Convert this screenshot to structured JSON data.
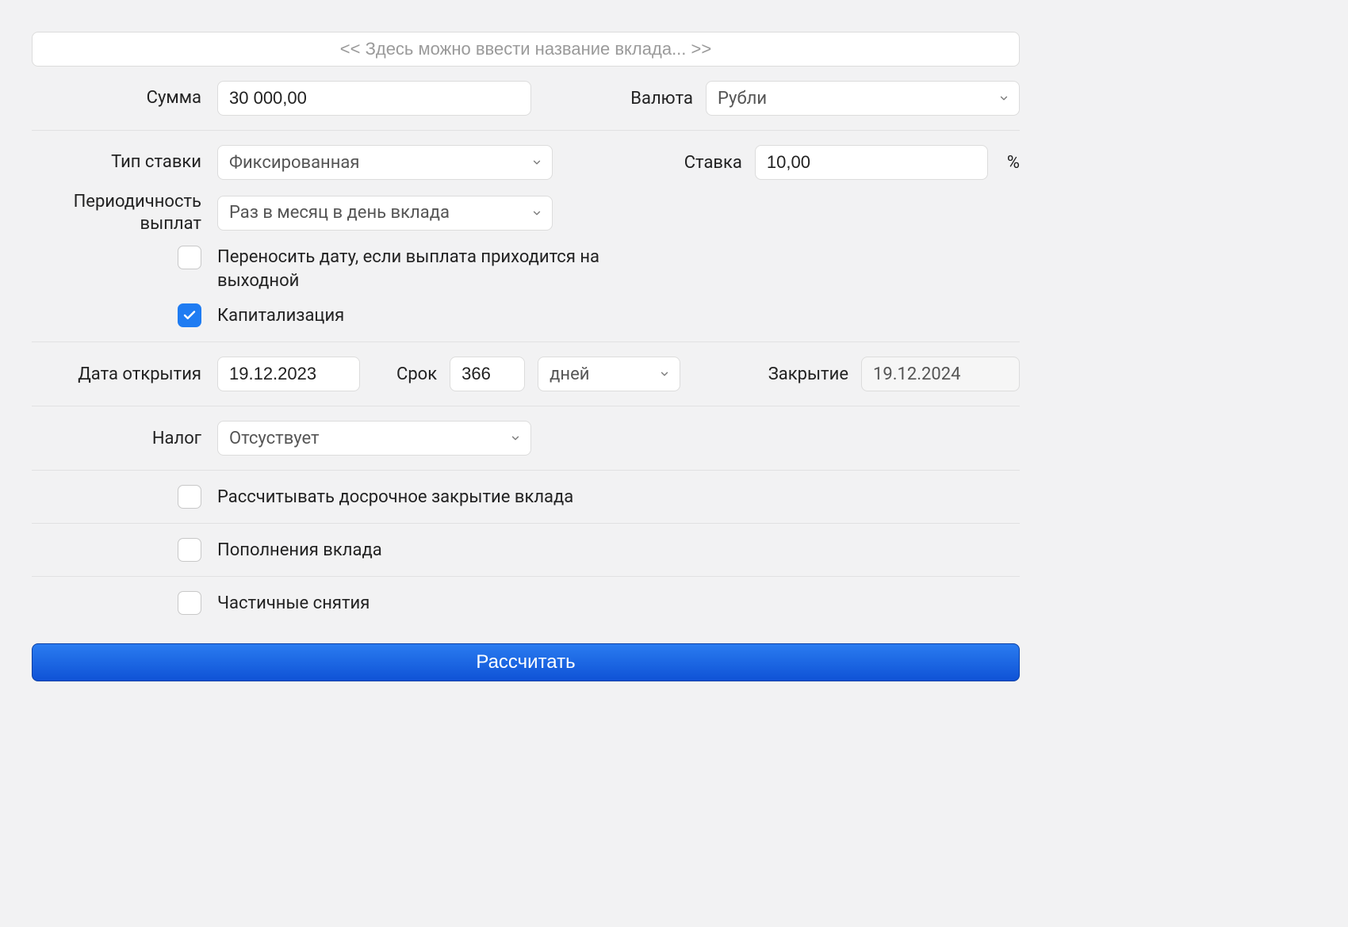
{
  "title_placeholder": "<< Здесь можно ввести название вклада... >>",
  "labels": {
    "amount": "Сумма",
    "currency": "Валюта",
    "rate_type": "Тип ставки",
    "rate": "Ставка",
    "percent": "%",
    "pay_freq": "Периодичность выплат",
    "shift_weekend": "Переносить дату, если выплата приходится на выходной",
    "capitalization": "Капитализация",
    "open_date": "Дата открытия",
    "term": "Срок",
    "close_date": "Закрытие",
    "tax": "Налог",
    "early_close": "Рассчитывать досрочное закрытие вклада",
    "topups": "Пополнения вклада",
    "withdrawals": "Частичные снятия",
    "calculate": "Рассчитать"
  },
  "values": {
    "amount": "30 000,00",
    "currency": "Рубли",
    "rate_type": "Фиксированная",
    "rate": "10,00",
    "pay_freq": "Раз в месяц в день вклада",
    "shift_weekend_checked": false,
    "capitalization_checked": true,
    "open_date": "19.12.2023",
    "term_value": "366",
    "term_unit": "дней",
    "close_date": "19.12.2024",
    "tax": "Отсуствует",
    "early_close_checked": false,
    "topups_checked": false,
    "withdrawals_checked": false
  }
}
